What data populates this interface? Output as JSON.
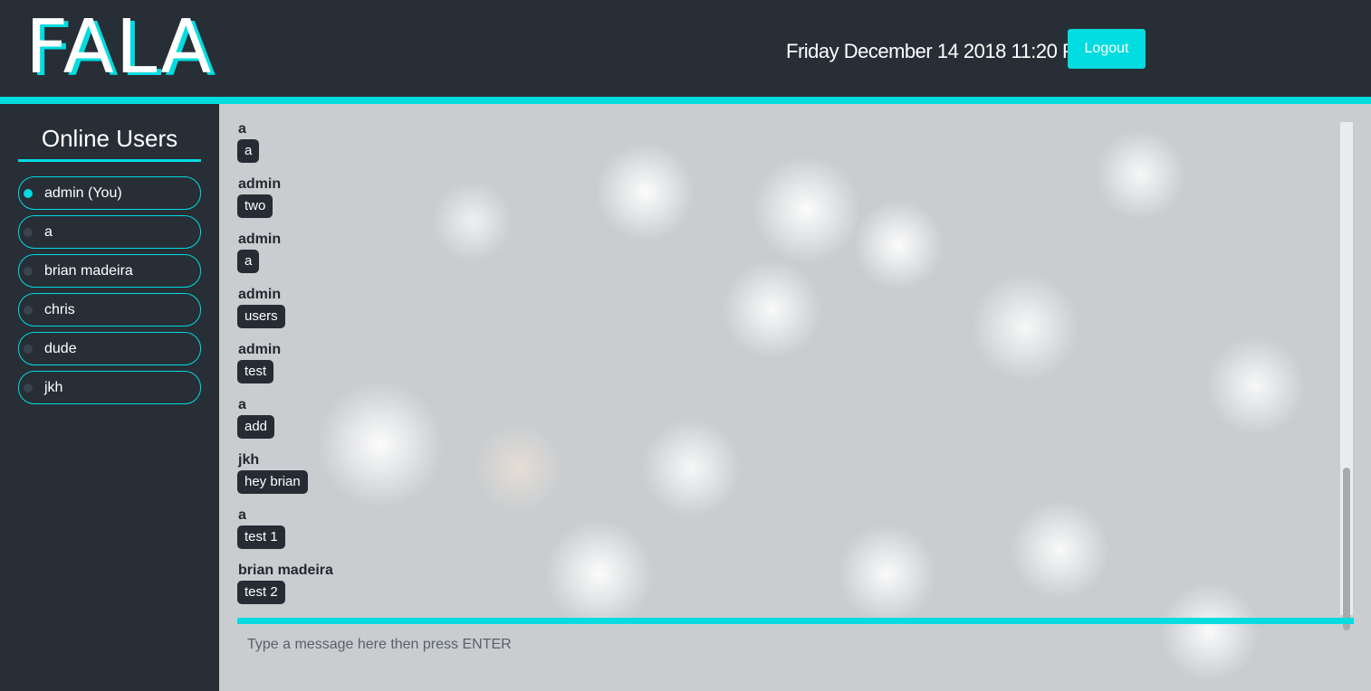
{
  "header": {
    "logo": "FALA",
    "datetime": "Friday December 14 2018 11:20 PM",
    "logout_label": "Logout"
  },
  "colors": {
    "accent": "#00dce0",
    "dark": "#272e36"
  },
  "sidebar": {
    "title": "Online Users",
    "users": [
      {
        "name": "admin (You)",
        "online": true
      },
      {
        "name": "a",
        "online": false
      },
      {
        "name": "brian madeira",
        "online": false
      },
      {
        "name": "chris",
        "online": false
      },
      {
        "name": "dude",
        "online": false
      },
      {
        "name": "jkh",
        "online": false
      }
    ]
  },
  "messages": [
    {
      "sender": "a",
      "text": "a"
    },
    {
      "sender": "admin",
      "text": "two"
    },
    {
      "sender": "admin",
      "text": "a"
    },
    {
      "sender": "admin",
      "text": "users"
    },
    {
      "sender": "admin",
      "text": "test"
    },
    {
      "sender": "a",
      "text": "add"
    },
    {
      "sender": "jkh",
      "text": "hey brian"
    },
    {
      "sender": "a",
      "text": "test 1"
    },
    {
      "sender": "brian madeira",
      "text": "test 2"
    }
  ],
  "composer": {
    "placeholder": "Type a message here then press ENTER",
    "value": ""
  }
}
